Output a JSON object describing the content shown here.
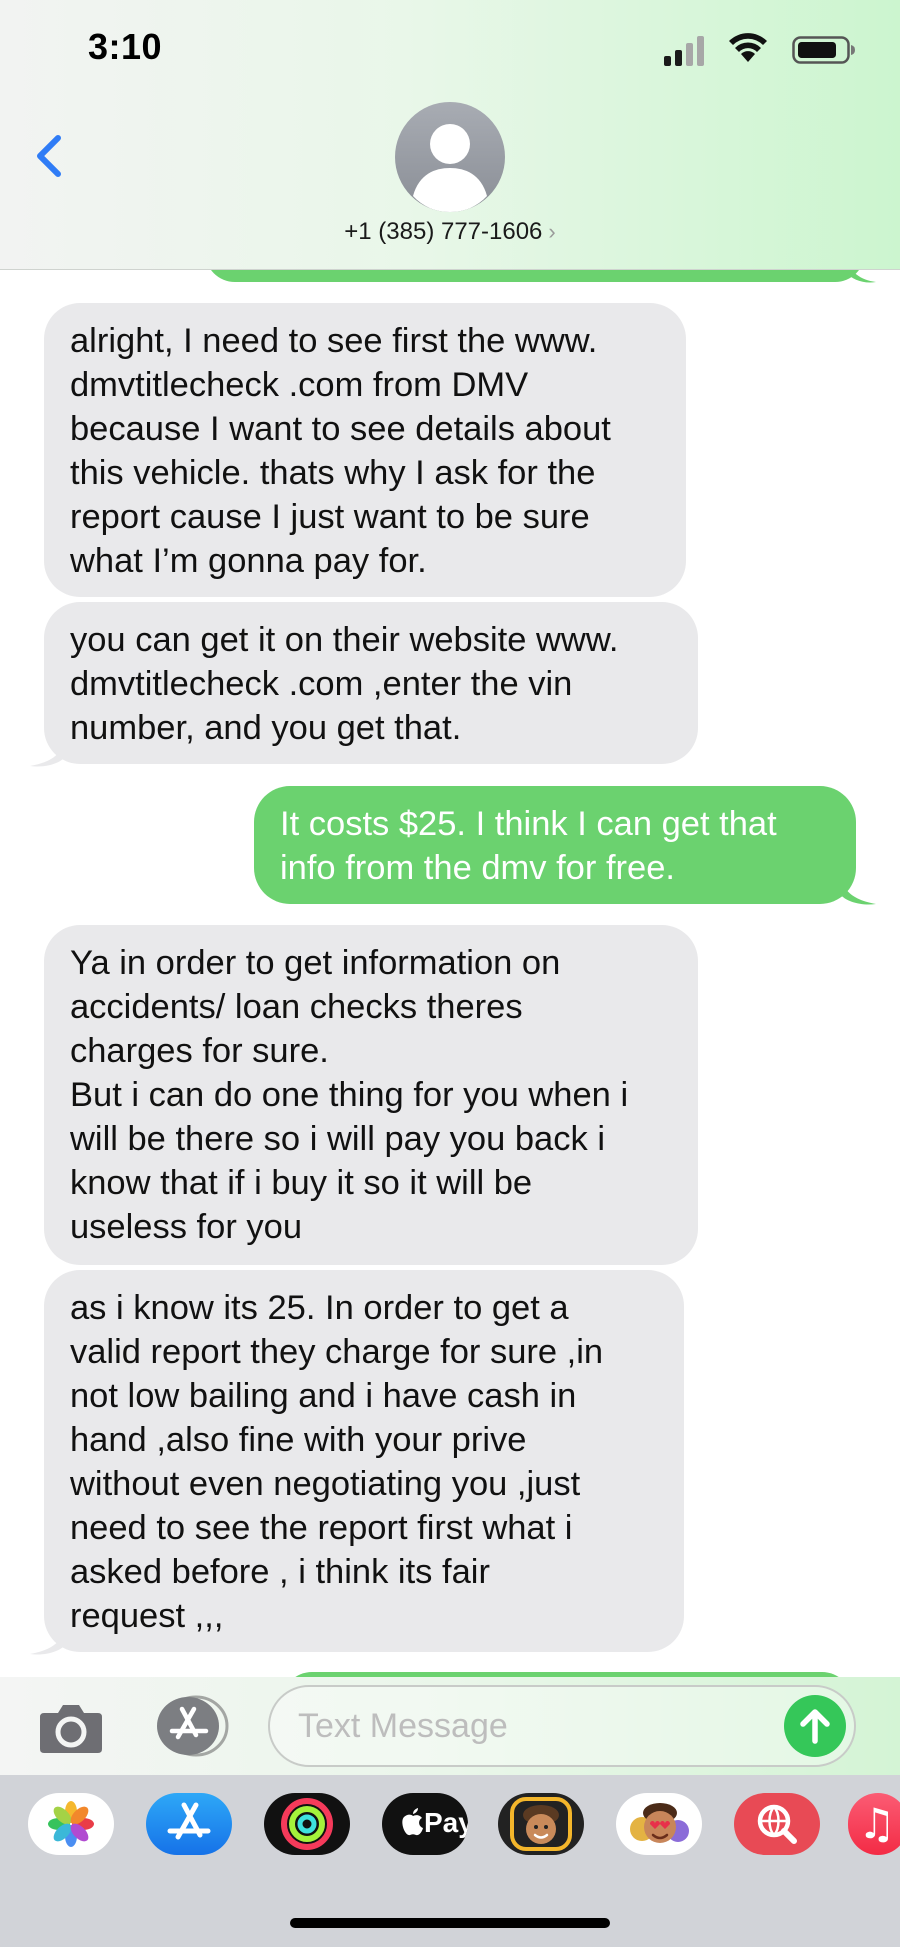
{
  "status_bar": {
    "time": "3:10"
  },
  "header": {
    "back_icon": "chevron-left-icon",
    "avatar_icon": "person-silhouette-icon",
    "contact": "+1 (385) 777-1606",
    "contact_chevron": "›"
  },
  "messages": [
    {
      "direction": "received",
      "text": "alright, I need to see first the www.\ndmvtitlecheck .com from DMV\nbecause I want to see details about\nthis vehicle. thats why I ask for the\nreport cause I just want to be sure\nwhat I’m gonna pay for."
    },
    {
      "direction": "received",
      "text": "you can get it on their website www.\ndmvtitlecheck .com ,enter the vin\nnumber, and you get that."
    },
    {
      "direction": "sent",
      "text": "It costs $25. I think I can get that\ninfo from the dmv for free."
    },
    {
      "direction": "received",
      "text": "Ya in order to get information on\naccidents/ loan checks theres\ncharges for sure.\nBut i can do one thing for you when i\nwill be there so i will pay you back i\nknow that if i buy it so it will be\nuseless for you"
    },
    {
      "direction": "received",
      "text": "as i know its 25. In order to get a\nvalid report they charge for sure ,in\nnot low bailing and i have cash in\nhand ,also fine with your prive\nwithout even negotiating you ,just\nneed to see the report first what i\nasked before , i think its fair\nrequest ,,,"
    }
  ],
  "compose": {
    "placeholder": "Text Message",
    "camera_icon": "camera-icon",
    "apps_icon": "app-store-icon",
    "send_icon": "arrow-up-icon"
  },
  "app_drawer": {
    "apps": [
      {
        "name": "photos",
        "icon": "photos-icon"
      },
      {
        "name": "app-store",
        "icon": "app-store-icon"
      },
      {
        "name": "activity",
        "icon": "activity-rings-icon"
      },
      {
        "name": "apple-pay",
        "icon": "apple-pay-icon",
        "label": "Pay"
      },
      {
        "name": "memoji",
        "icon": "memoji-icon"
      },
      {
        "name": "memoji-stickers",
        "icon": "memoji-stickers-icon"
      },
      {
        "name": "image-search",
        "icon": "globe-search-icon"
      },
      {
        "name": "music",
        "icon": "music-note-icon",
        "label": "♫"
      }
    ]
  },
  "colors": {
    "sent_bubble": "#6bd26f",
    "received_bubble": "#e9e9eb",
    "ios_blue": "#2f7cf6",
    "send_button": "#35c759"
  }
}
